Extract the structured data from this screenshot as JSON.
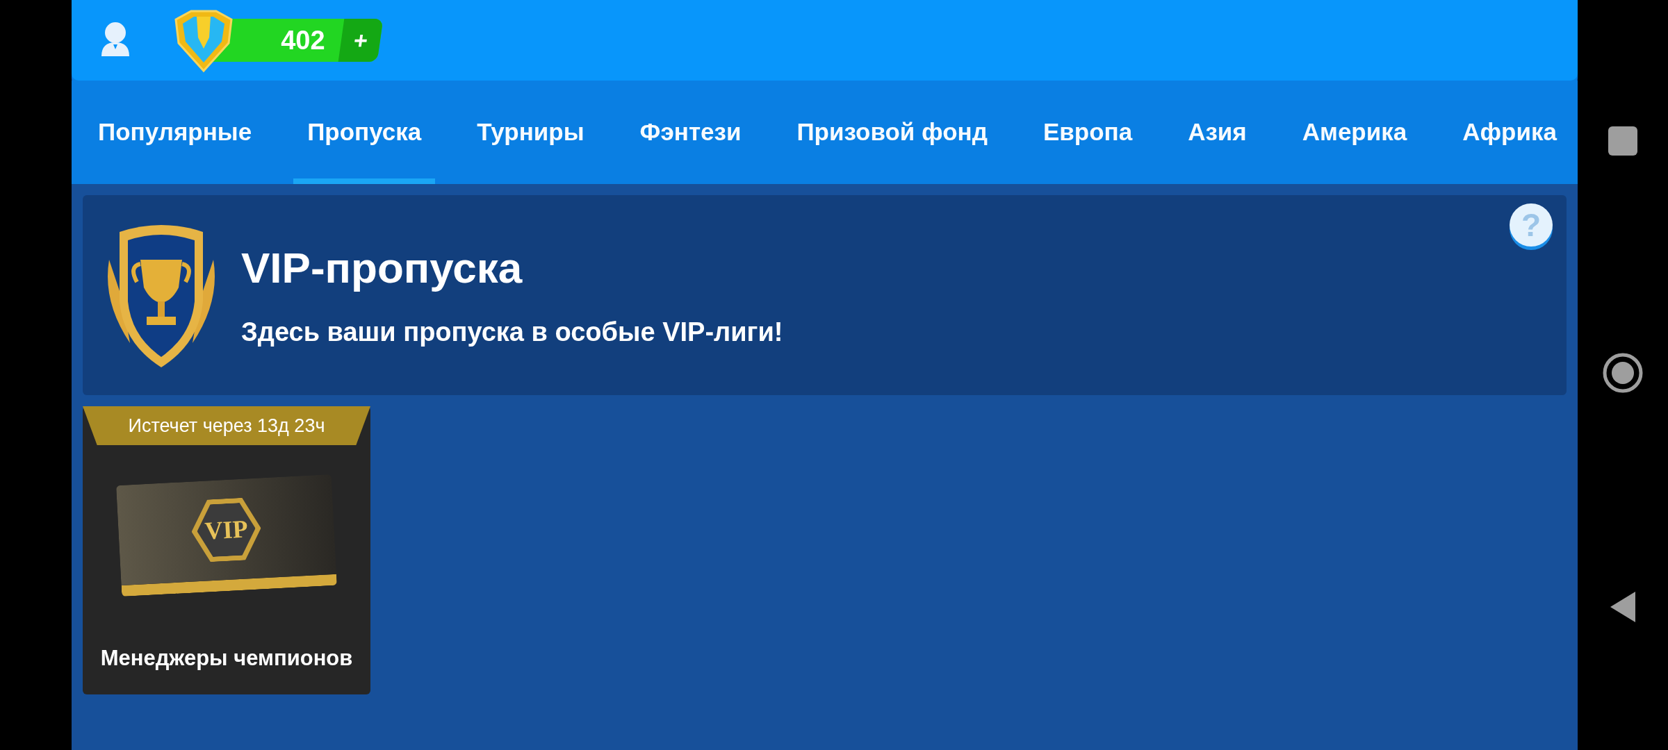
{
  "top_bar": {
    "coins": "402",
    "add_label": "+"
  },
  "tabs": [
    {
      "label": "Популярные",
      "selected": false
    },
    {
      "label": "Пропуска",
      "selected": true
    },
    {
      "label": "Турниры",
      "selected": false
    },
    {
      "label": "Фэнтези",
      "selected": false
    },
    {
      "label": "Призовой фонд",
      "selected": false
    },
    {
      "label": "Европа",
      "selected": false
    },
    {
      "label": "Азия",
      "selected": false
    },
    {
      "label": "Америка",
      "selected": false
    },
    {
      "label": "Африка",
      "selected": false
    }
  ],
  "banner": {
    "title": "VIP-пропуска",
    "subtitle": "Здесь ваши пропуска в особые VIP-лиги!",
    "help_label": "?"
  },
  "passes": [
    {
      "expires": "Истечет через 13д 23ч",
      "ticket_label": "VIP",
      "name": "Менеджеры чемпионов"
    }
  ]
}
